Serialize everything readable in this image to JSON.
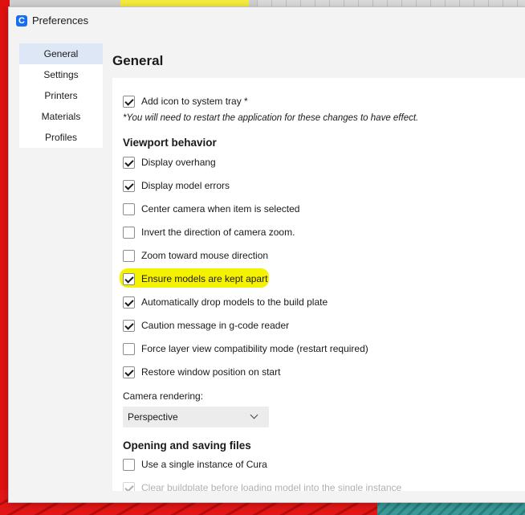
{
  "window": {
    "title": "Preferences"
  },
  "sidebar": {
    "items": [
      {
        "label": "General",
        "active": true
      },
      {
        "label": "Settings"
      },
      {
        "label": "Printers"
      },
      {
        "label": "Materials"
      },
      {
        "label": "Profiles"
      }
    ]
  },
  "page": {
    "title": "General",
    "tray": {
      "label": "Add icon to system tray *",
      "checked": true
    },
    "restart_note": "*You will need to restart the application for these changes to have effect.",
    "viewport": {
      "heading": "Viewport behavior",
      "options": [
        {
          "label": "Display overhang",
          "checked": true
        },
        {
          "label": "Display model errors",
          "checked": true
        },
        {
          "label": "Center camera when item is selected",
          "checked": false
        },
        {
          "label": "Invert the direction of camera zoom.",
          "checked": false
        },
        {
          "label": "Zoom toward mouse direction",
          "checked": false
        },
        {
          "label": "Ensure models are kept apart",
          "checked": true,
          "highlighted": true
        },
        {
          "label": "Automatically drop models to the build plate",
          "checked": true
        },
        {
          "label": "Caution message in g-code reader",
          "checked": true
        },
        {
          "label": "Force layer view compatibility mode (restart required)",
          "checked": false
        },
        {
          "label": "Restore window position on start",
          "checked": true
        }
      ]
    },
    "camera_rendering": {
      "label": "Camera rendering:",
      "value": "Perspective"
    },
    "files": {
      "heading": "Opening and saving files",
      "options": [
        {
          "label": "Use a single instance of Cura",
          "checked": false
        },
        {
          "label": "Clear buildplate before loading model into the single instance",
          "checked": true
        }
      ]
    }
  }
}
